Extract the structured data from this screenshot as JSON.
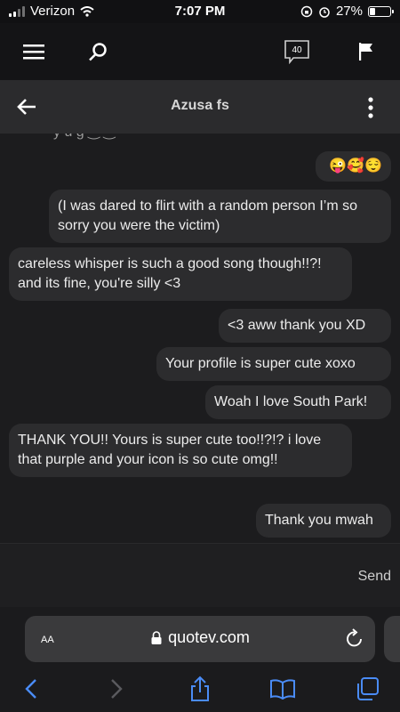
{
  "status_bar": {
    "carrier": "Verizon",
    "time": "7:07 PM",
    "battery": "27%",
    "battery_level": 0.27
  },
  "site_nav": {
    "notifications_count": "40"
  },
  "chat": {
    "title": "Azusa fs",
    "messages": [
      {
        "side": "right",
        "text": "😜🥰😌"
      },
      {
        "side": "right",
        "text": "(I was dared to flirt with a random person I’m so sorry you were the victim)"
      },
      {
        "side": "left",
        "text": "careless whisper is such a good song though!!?! and its fine, you're silly <3"
      },
      {
        "side": "right",
        "text": "<3 aww thank you XD"
      },
      {
        "side": "right",
        "text": "Your profile is super cute xoxo"
      },
      {
        "side": "right",
        "text": "Woah I love South Park!"
      },
      {
        "side": "left",
        "text": "THANK YOU!! Yours is super cute too!!?!? i love that purple and your icon is so cute omg!!"
      },
      {
        "side": "right",
        "text": "Thank you mwah"
      }
    ]
  },
  "composer": {
    "send_label": "Send"
  },
  "browser": {
    "aa_label": "AA",
    "url": "quotev.com"
  },
  "icons": {
    "menu": "menu-icon",
    "search": "search-icon",
    "notifications": "notifications-icon",
    "flag": "flag-icon",
    "back": "back-arrow-icon",
    "more": "more-vertical-icon",
    "lock": "lock-icon",
    "reload": "reload-icon",
    "safari_back": "chevron-left-icon",
    "safari_forward": "chevron-right-icon",
    "share": "share-icon",
    "bookmarks": "bookmarks-icon",
    "tabs": "tabs-icon"
  }
}
